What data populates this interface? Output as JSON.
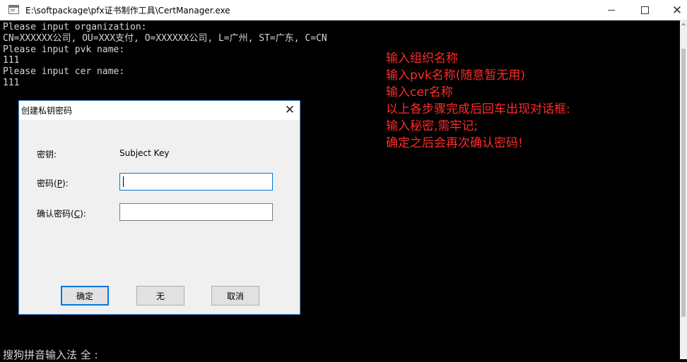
{
  "window": {
    "title": "E:\\softpackage\\pfx证书制作工具\\CertManager.exe",
    "minimize_icon": "minimize-icon",
    "maximize_icon": "maximize-icon",
    "close_glyph": "✕"
  },
  "console": {
    "lines": [
      "Please input organization:",
      "CN=XXXXXX公司, OU=XXX支付, O=XXXXXX公司, L=广州, ST=广东, C=CN",
      "Please input pvk name:",
      "111",
      "Please input cer name:",
      "111"
    ]
  },
  "notes": [
    "输入组织名称",
    "输入pvk名称(随意暂无用)",
    "输入cer名称",
    "以上各步骤完成后回车出现对话框:",
    "输入秘密,需牢记;",
    "确定之后会再次确认密码!"
  ],
  "dialog": {
    "title": "创建私钥密码",
    "close_glyph": "✕",
    "key_label": "密钥:",
    "key_value": "Subject Key",
    "password_label_prefix": "密码(",
    "password_label_accel": "P",
    "password_label_suffix": "):",
    "password_value": "",
    "confirm_label_prefix": "确认密码(",
    "confirm_label_accel": "C",
    "confirm_label_suffix": "):",
    "confirm_value": "",
    "ok_label": "确定",
    "none_label": "无",
    "cancel_label": "取消"
  },
  "ime": {
    "text": "搜狗拼音输入法 全 :"
  },
  "colors": {
    "annotation": "#ff2b2b",
    "focus": "#0078d7"
  }
}
